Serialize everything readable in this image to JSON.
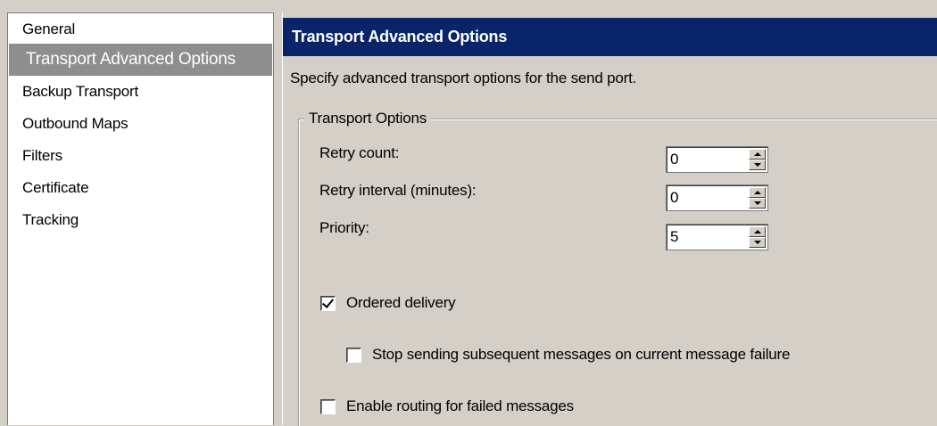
{
  "nav": {
    "items": [
      {
        "label": "General",
        "selected": false
      },
      {
        "label": "Transport Advanced Options",
        "selected": true
      },
      {
        "label": "Backup Transport",
        "selected": false
      },
      {
        "label": "Outbound Maps",
        "selected": false
      },
      {
        "label": "Filters",
        "selected": false
      },
      {
        "label": "Certificate",
        "selected": false
      },
      {
        "label": "Tracking",
        "selected": false
      }
    ]
  },
  "panel": {
    "title": "Transport Advanced Options",
    "description": "Specify advanced transport options for the send port.",
    "group": {
      "legend": "Transport Options",
      "retry_count": {
        "label": "Retry count:",
        "value": "0"
      },
      "retry_interval": {
        "label": "Retry interval (minutes):",
        "value": "0"
      },
      "priority": {
        "label": "Priority:",
        "value": "5"
      },
      "ordered_delivery": {
        "label": "Ordered delivery",
        "checked": true
      },
      "stop_sending": {
        "label": "Stop sending subsequent messages on current message failure",
        "checked": false
      },
      "enable_routing": {
        "label": "Enable routing for failed messages",
        "checked": false
      }
    }
  },
  "colors": {
    "header_bg": "#0a246a",
    "selected_bg": "#8e8e8e",
    "window_bg": "#d4d0c8"
  },
  "icons": {
    "spinner_up": "up-arrow-icon",
    "spinner_down": "down-arrow-icon",
    "checkmark": "checkmark-icon"
  }
}
